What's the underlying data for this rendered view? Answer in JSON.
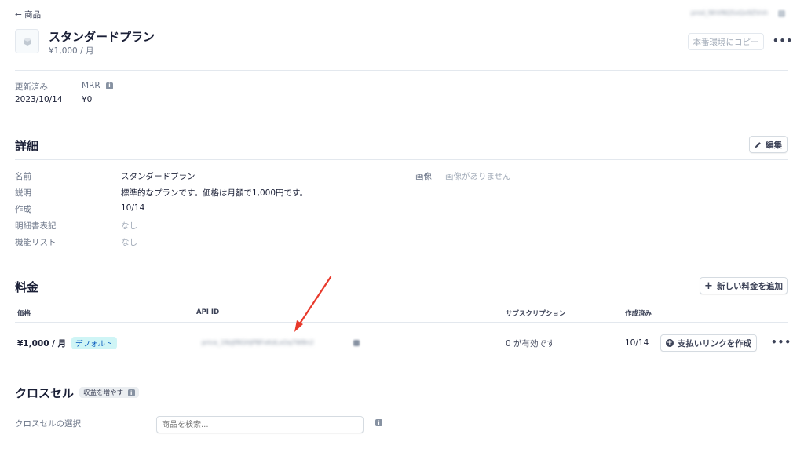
{
  "nav": {
    "back_label": "← 商品",
    "top_right_blurred": "prod_NhVNQ5xQx9ZVnh"
  },
  "product": {
    "name": "スタンダードプラン",
    "price_line": "¥1,000 / 月"
  },
  "header_actions": {
    "copy_label": "本番環境にコピー",
    "more": "•••"
  },
  "summary": {
    "updated_label": "更新済み",
    "updated_value": "2023/10/14",
    "mrr_label": "MRR",
    "mrr_value": "¥0"
  },
  "details": {
    "title": "詳細",
    "edit_label": "編集",
    "fields": [
      {
        "label": "名前",
        "value": "スタンダードプラン"
      },
      {
        "label": "説明",
        "value": "標準的なプランです。価格は月額で1,000円です。"
      },
      {
        "label": "作成",
        "value": "10/14"
      },
      {
        "label": "明細書表記",
        "value": "なし"
      },
      {
        "label": "機能リスト",
        "value": "なし"
      }
    ],
    "image_label": "画像",
    "image_value": "画像がありません"
  },
  "pricing": {
    "title": "料金",
    "add_label": "新しい料金を追加",
    "columns": [
      "価格",
      "API ID",
      "サブスクリプション",
      "作成済み"
    ],
    "rows": [
      {
        "price": "¥1,000 / 月",
        "badge": "デフォルト",
        "api_id": "price_1NzJf8GHjPBFxKdLxOq7W8n2",
        "subscriptions": "0 が有効です",
        "created": "10/14",
        "link_label": "支払いリンクを作成",
        "more": "•••"
      }
    ]
  },
  "crosssell": {
    "title": "クロスセル",
    "badge": "収益を増やす",
    "select_label": "クロスセルの選択",
    "search_placeholder": "商品を検索..."
  },
  "colors": {
    "annotation_arrow": "#e8392b",
    "badge_bg": "#cff5f6",
    "badge_text": "#0055bc"
  }
}
